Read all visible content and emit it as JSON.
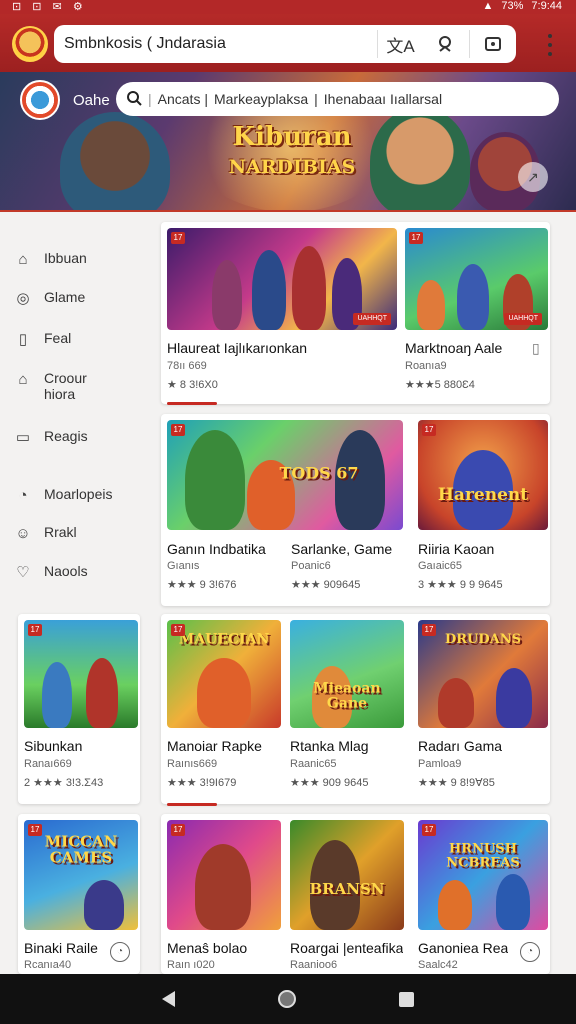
{
  "status_bar": {
    "left_icons": "⊡ ⊡ ✉ ⚙",
    "battery": "73%",
    "time": "7:9:44"
  },
  "browser": {
    "url_text": "Smbnkosis  ( Jndarasia",
    "translate_label": "文A",
    "search_icon": "search-icon",
    "tab_icon": "tab-switcher-icon"
  },
  "hero": {
    "label": "Oahe",
    "search_items": [
      "Ancats |",
      "Markeayplaksa",
      "|",
      "Ihenabaaı Iıallarsal"
    ],
    "title_line1": "Kiburan",
    "title_line2": "NARDIBIAS"
  },
  "sidebar": {
    "items": [
      {
        "icon": "home-icon",
        "label": "Ibbuan"
      },
      {
        "icon": "game-icon",
        "label": "Glame"
      },
      {
        "icon": "bookmark-icon",
        "label": "Feal"
      },
      {
        "icon": "group-icon",
        "label": "Croour",
        "label2": "hiora"
      },
      {
        "icon": "reader-icon",
        "label": "Reagis"
      },
      {
        "icon": "moderation-icon",
        "label": "Moarlopeis"
      },
      {
        "icon": "rank-icon",
        "label": "Rrakl"
      },
      {
        "icon": "location-icon",
        "label": "Naools"
      }
    ]
  },
  "cards": [
    {
      "title": "Hlaureat Iajlıkarıonkan",
      "sub": "78ıı 669",
      "rating": "★ 8 3!6X0",
      "art": "",
      "badge": "17",
      "tag": "UAHHQT"
    },
    {
      "title": "Marktnoaŋ Aale",
      "sub": "Roanıa9",
      "rating": "★★★5 880Ɛ4",
      "art": "",
      "badge": "17",
      "tag": "UAHHQT"
    },
    {
      "title": "Ganın Indbatika",
      "sub": "Gıanıs",
      "rating": "★★★ 9 3!676",
      "art": "",
      "badge": "17",
      "tag": ""
    },
    {
      "title": "Sarlanke, Game",
      "sub": "Poanic6",
      "rating": "★★★ 909645",
      "art": "TODS 67",
      "badge": "",
      "tag": ""
    },
    {
      "title": "Riiria Kaoan",
      "sub": "Gaıaic65",
      "rating": "3 ★★★ 9 9 9645",
      "art": "Harenent",
      "badge": "17",
      "tag": ""
    },
    {
      "title": "Sibunkan",
      "sub": "Ranaı669",
      "rating": "2 ★★★ 3!3.Ʃ43",
      "art": "",
      "badge": "17",
      "tag": ""
    },
    {
      "title": "Manoiar Rapke",
      "sub": "Raınıs669",
      "rating": "★★★ 3!9I679",
      "art": "MAUECIAN",
      "badge": "17",
      "tag": ""
    },
    {
      "title": "Rtanka Mlag",
      "sub": "Raanic65",
      "rating": "★★★ 909 9645",
      "art": "Mieaoan Gane",
      "badge": "",
      "tag": ""
    },
    {
      "title": "Radarı Gama",
      "sub": "Pamloa9",
      "rating": "★★★ 9 8!9Ɐ85",
      "art": "DRUDANS",
      "badge": "17",
      "tag": ""
    },
    {
      "title": "Binaki Raile",
      "sub": "Rcanıa40",
      "rating": "",
      "art": "MICCAN CAMES",
      "badge": "17",
      "tag": ""
    },
    {
      "title": "Menaŝ bolao",
      "sub": "Raın ı020",
      "rating": "",
      "art": "",
      "badge": "17",
      "tag": ""
    },
    {
      "title": "Roargai |enteafika",
      "sub": "Raanioo6",
      "rating": "",
      "art": "BRANSN",
      "badge": "",
      "tag": ""
    },
    {
      "title": "Ganoniea Rea",
      "sub": "Saalc42",
      "rating": "",
      "art": "HRNUSH NCBREAS",
      "badge": "17",
      "tag": ""
    }
  ],
  "colors": {
    "brand_red": "#b32828",
    "accent": "#c62a22"
  }
}
